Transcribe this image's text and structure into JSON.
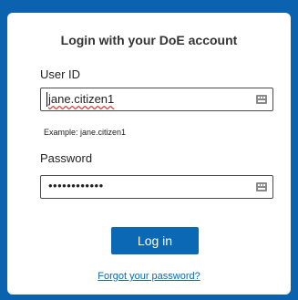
{
  "login": {
    "title": "Login with your DoE account",
    "user_id_label": "User ID",
    "user_id_value": "jane.citizen1",
    "user_id_example": "Example: jane.citizen1",
    "password_label": "Password",
    "password_masked": "••••••••••••",
    "login_button": "Log in",
    "forgot_link": "Forgot your password?"
  },
  "icons": [
    "password-manager-key-icon",
    "password-manager-key-icon"
  ],
  "colors": {
    "background": "#0b63b0",
    "card": "#ffffff",
    "button": "#0a68b4",
    "link": "#0a68b4"
  }
}
